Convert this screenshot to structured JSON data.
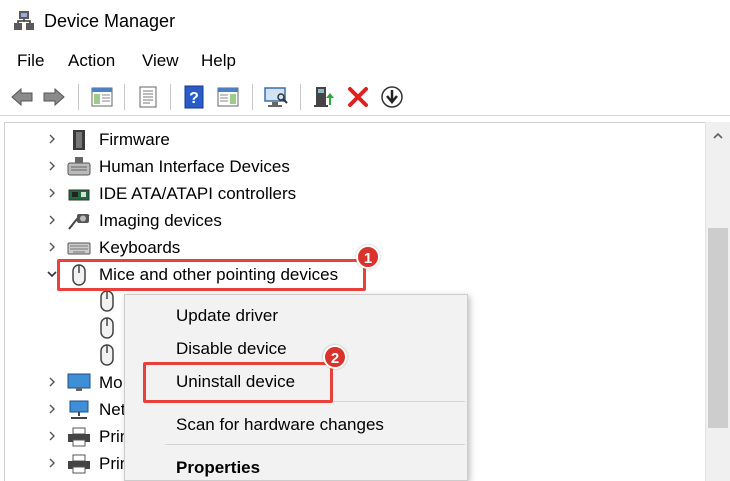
{
  "window": {
    "title": "Device Manager"
  },
  "menu": {
    "items": [
      "File",
      "Action",
      "View",
      "Help"
    ]
  },
  "toolbar": {
    "icons": [
      "back-arrow-icon",
      "forward-arrow-icon",
      "show-hide-tree-icon",
      "properties-icon",
      "help-icon",
      "action-pane-icon",
      "scan-hardware-icon",
      "update-driver-icon",
      "uninstall-x-icon",
      "disable-download-icon"
    ],
    "uninstall_color": "#e0201e"
  },
  "tree": {
    "categories": [
      {
        "label": "Firmware",
        "expanded": false
      },
      {
        "label": "Human Interface Devices",
        "expanded": false
      },
      {
        "label": "IDE ATA/ATAPI controllers",
        "expanded": false
      },
      {
        "label": "Imaging devices",
        "expanded": false
      },
      {
        "label": "Keyboards",
        "expanded": false
      },
      {
        "label": "Mice and other pointing devices",
        "expanded": true
      },
      {
        "label": "Mo",
        "expanded": false
      },
      {
        "label": "Net",
        "expanded": false
      },
      {
        "label": "Prin",
        "expanded": false
      },
      {
        "label": "Prin",
        "expanded": false
      }
    ],
    "child_devices": 3
  },
  "context_menu": {
    "items": [
      "Update driver",
      "Disable device",
      "Uninstall device",
      "Scan for hardware changes",
      "Properties"
    ]
  },
  "annotations": {
    "badge1": "1",
    "badge2": "2",
    "highlight_color": "#e8413c"
  }
}
